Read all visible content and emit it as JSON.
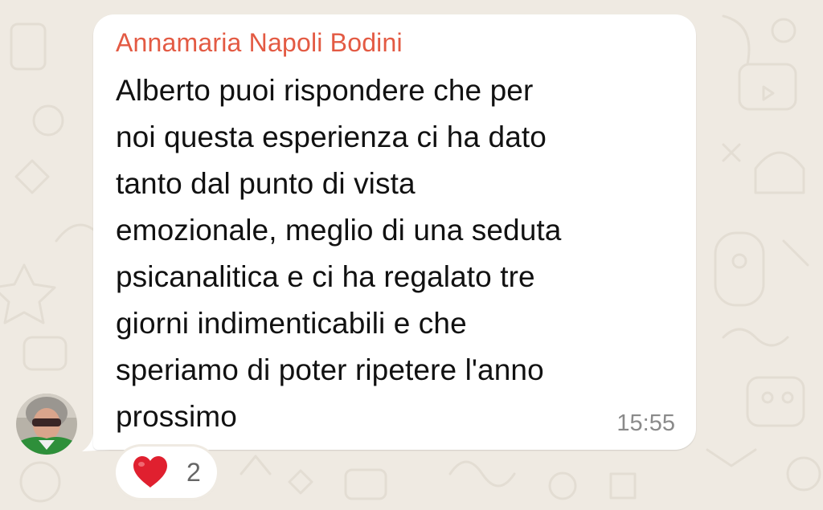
{
  "message": {
    "sender": "Annamaria Napoli Bodini",
    "text": "Alberto puoi rispondere che per\nnoi questa esperienza ci ha dato\ntanto  dal punto di vista\nemozionale, meglio di una seduta\npsicanalitica e ci ha regalato tre\ngiorni indimenticabili e che\nsperiamo di poter ripetere l'anno\nprossimo",
    "time": "15:55"
  },
  "reaction": {
    "emoji": "heart-icon",
    "count": "2"
  },
  "colors": {
    "background": "#efeae2",
    "bubble": "#ffffff",
    "sender_name": "#e35a43",
    "timestamp": "#8a8a8a",
    "heart": "#e0202f"
  },
  "icons": [
    "chat-wallpaper-doodles",
    "heart-icon",
    "avatar"
  ]
}
